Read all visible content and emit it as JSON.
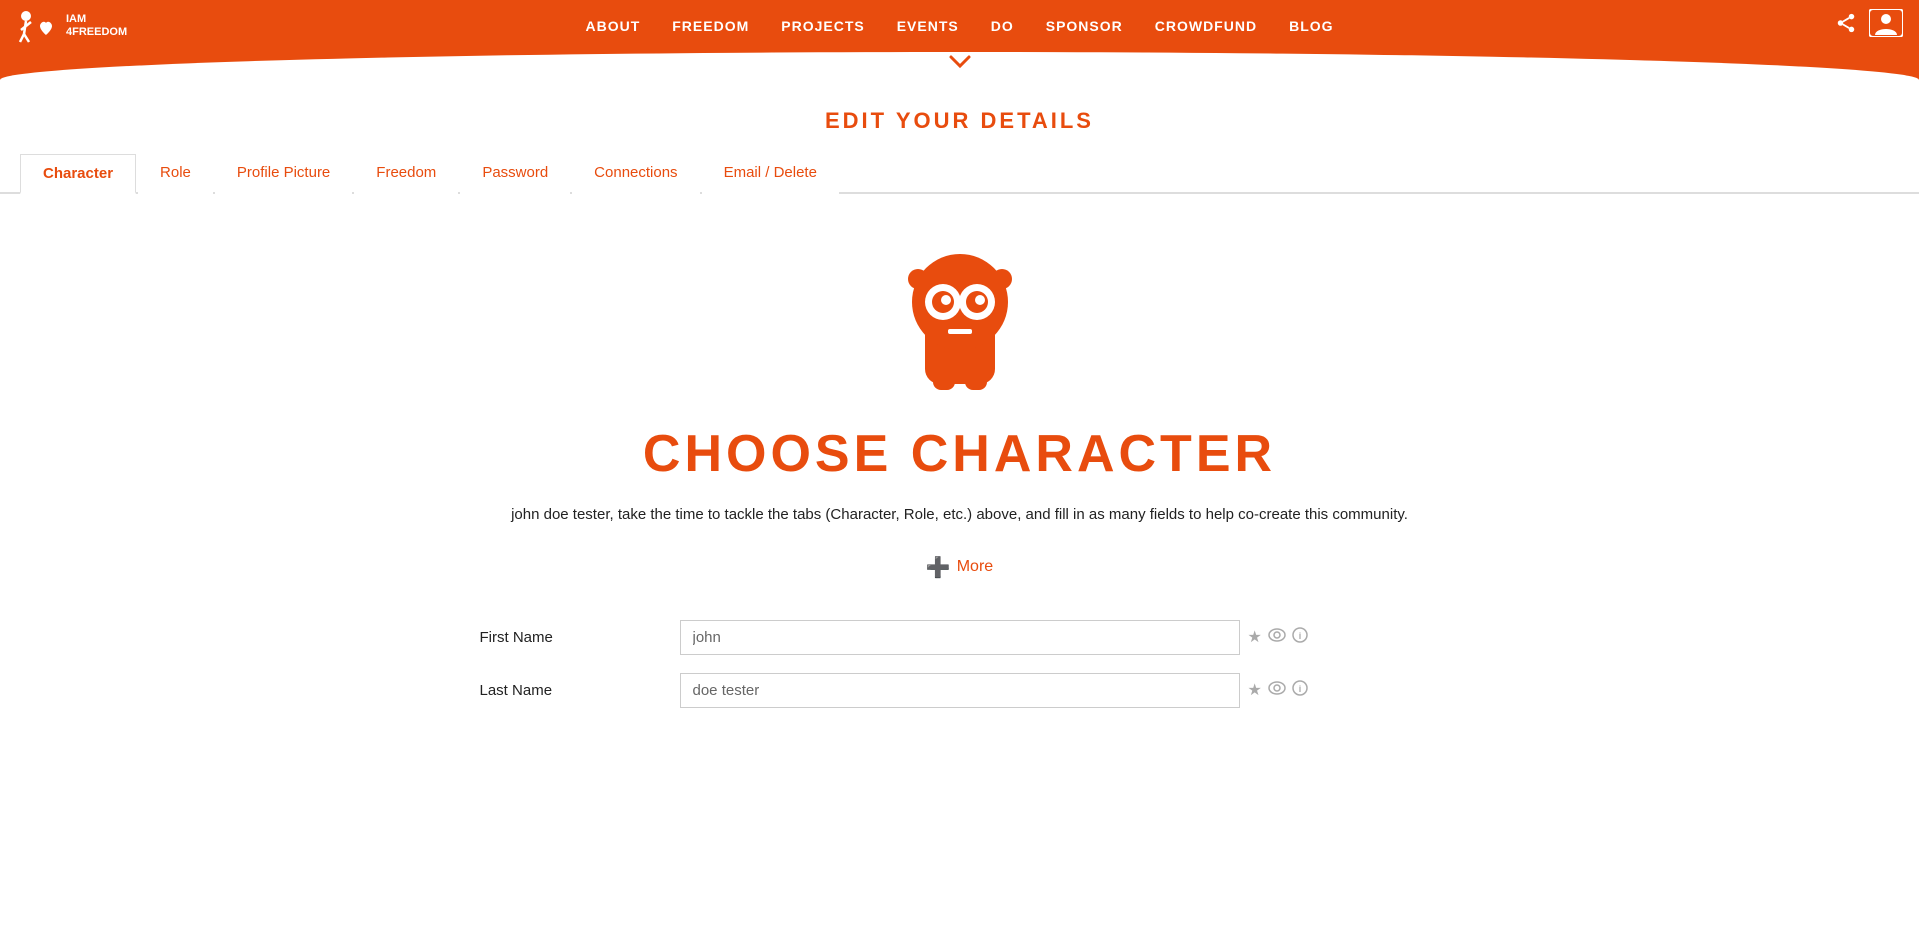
{
  "header": {
    "logo_text": "IAM 4FREEDOM",
    "nav_items": [
      {
        "label": "ABOUT",
        "href": "#"
      },
      {
        "label": "FREEDOM",
        "href": "#"
      },
      {
        "label": "PROJECTS",
        "href": "#"
      },
      {
        "label": "EVENTS",
        "href": "#"
      },
      {
        "label": "DO",
        "href": "#"
      },
      {
        "label": "SPONSOR",
        "href": "#"
      },
      {
        "label": "CROWDFUND",
        "href": "#"
      },
      {
        "label": "BLOG",
        "href": "#"
      }
    ],
    "share_icon": "share",
    "user_icon": "user"
  },
  "page": {
    "title": "EDIT YOUR DETAILS"
  },
  "tabs": [
    {
      "label": "Character",
      "active": true
    },
    {
      "label": "Role",
      "active": false
    },
    {
      "label": "Profile Picture",
      "active": false
    },
    {
      "label": "Freedom",
      "active": false
    },
    {
      "label": "Password",
      "active": false
    },
    {
      "label": "Connections",
      "active": false
    },
    {
      "label": "Email / Delete",
      "active": false
    }
  ],
  "character_section": {
    "title": "CHOOSE CHARACTER",
    "subtitle": "john doe tester, take the time to tackle the tabs (Character, Role, etc.) above, and fill in as many fields to help co-create this community.",
    "more_label": "More"
  },
  "form": {
    "fields": [
      {
        "label": "First Name",
        "value": "john",
        "placeholder": "john"
      },
      {
        "label": "Last Name",
        "value": "doe tester",
        "placeholder": "doe tester"
      }
    ]
  },
  "colors": {
    "brand_orange": "#e84c0e",
    "white": "#ffffff",
    "text_dark": "#222222",
    "border": "#cccccc"
  }
}
